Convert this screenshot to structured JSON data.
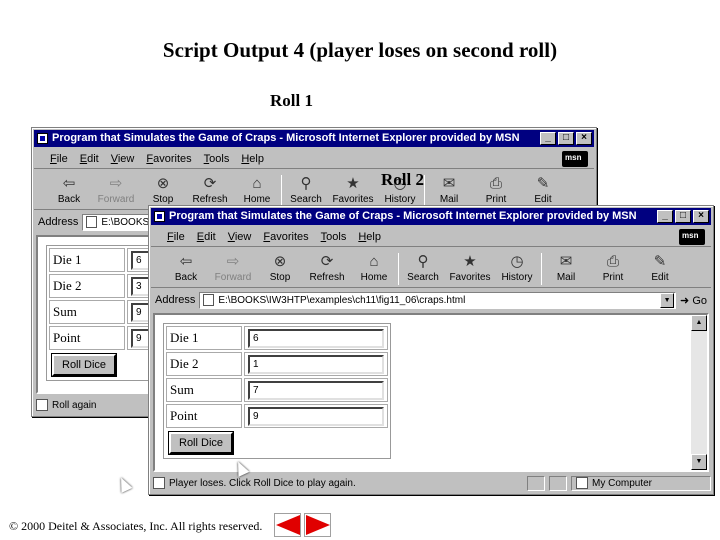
{
  "slide": {
    "title": "Script Output 4 (player loses on second roll)",
    "roll1_caption": "Roll 1",
    "roll2_caption": "Roll 2",
    "footer": "© 2000 Deitel & Associates, Inc.  All rights reserved."
  },
  "browser": {
    "title": "Program that Simulates the Game of Craps - Microsoft Internet Explorer provided by MSN",
    "menu": [
      "File",
      "Edit",
      "View",
      "Favorites",
      "Tools",
      "Help"
    ],
    "toolbar": [
      "Back",
      "Forward",
      "Stop",
      "Refresh",
      "Home",
      "Search",
      "Favorites",
      "History",
      "Mail",
      "Print",
      "Edit"
    ],
    "address_label": "Address",
    "address": "E:\\BOOKS\\IW3HTP\\examples\\ch11\\fig11_06\\craps.html",
    "address_window1": "E:\\BOOKS",
    "go": "Go",
    "zone": "My Computer"
  },
  "window1": {
    "labels": [
      "Die 1",
      "Die 2",
      "Sum",
      "Point"
    ],
    "values": [
      "6",
      "3",
      "9",
      "9"
    ],
    "button": "Roll Dice",
    "status": "Roll again"
  },
  "window2": {
    "labels": [
      "Die 1",
      "Die 2",
      "Sum",
      "Point"
    ],
    "values": [
      "6",
      "1",
      "7",
      "9"
    ],
    "button": "Roll Dice",
    "status": "Player loses. Click Roll Dice to play again."
  },
  "colors": {
    "titlebar": "#000080",
    "chrome": "#c0c0c0",
    "nav_arrow": "#e00000"
  }
}
